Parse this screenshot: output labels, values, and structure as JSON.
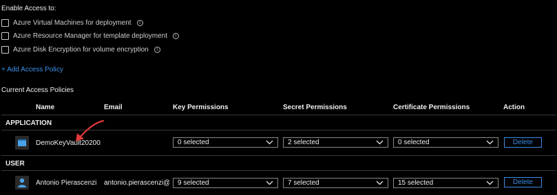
{
  "enable_access": {
    "heading": "Enable Access to:",
    "options": [
      {
        "label": "Azure Virtual Machines for deployment"
      },
      {
        "label": "Azure Resource Manager for template deployment"
      },
      {
        "label": "Azure Disk Encryption for volume encryption"
      }
    ],
    "info_glyph": "i"
  },
  "add_policy_label": "+ Add Access Policy",
  "current_policies_title": "Current Access Policies",
  "columns": [
    "Name",
    "Email",
    "Key Permissions",
    "Secret Permissions",
    "Certificate Permissions",
    "Action"
  ],
  "groups": [
    {
      "label": "APPLICATION",
      "row": {
        "icon": "application-icon",
        "name": "DemoKeyVault20200...",
        "email": "",
        "key": "0 selected",
        "secret": "2 selected",
        "certificate": "0 selected",
        "action": "Delete"
      }
    },
    {
      "label": "USER",
      "row": {
        "icon": "user-icon",
        "name": "Antonio Pierascenzi",
        "email": "antonio.pierascenzi@...",
        "key": "9 selected",
        "secret": "7 selected",
        "certificate": "15 selected",
        "action": "Delete"
      }
    }
  ],
  "colors": {
    "accent": "#3d8fe8",
    "annotation": "#e03a3a",
    "background": "#000000"
  }
}
